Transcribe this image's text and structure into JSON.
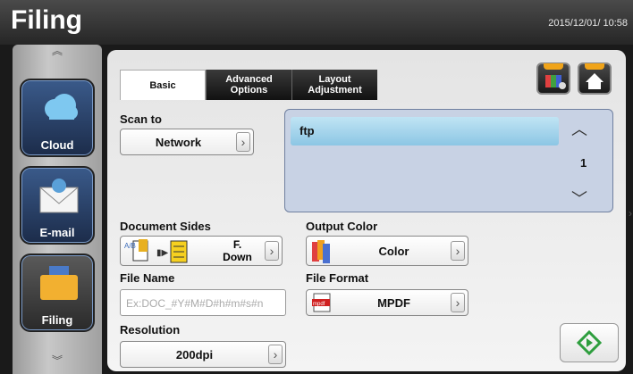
{
  "header": {
    "title": "Filing",
    "datetime": "2015/12/01/ 10:58"
  },
  "sidebar": {
    "items": [
      {
        "label": "Cloud",
        "icon": "cloud-icon"
      },
      {
        "label": "E-mail",
        "icon": "envelope-icon"
      },
      {
        "label": "Filing",
        "icon": "folder-icon"
      }
    ]
  },
  "tabs": [
    {
      "label": "Basic",
      "active": true
    },
    {
      "label": "Advanced Options",
      "active": false
    },
    {
      "label": "Layout Adjustment",
      "active": false
    }
  ],
  "toolbar": {
    "shortcut_icon": "color-settings-icon",
    "home_icon": "home-icon"
  },
  "scan_to": {
    "label": "Scan to",
    "value": "Network"
  },
  "destination_list": {
    "items": [
      "ftp"
    ],
    "page": "1"
  },
  "document_sides": {
    "label": "Document Sides",
    "value_line1": "F.",
    "value_line2": "Down"
  },
  "output_color": {
    "label": "Output Color",
    "value": "Color"
  },
  "file_name": {
    "label": "File Name",
    "placeholder": "Ex:DOC_#Y#M#D#h#m#s#n"
  },
  "file_format": {
    "label": "File Format",
    "value": "MPDF",
    "icon_text": "mpdf"
  },
  "resolution": {
    "label": "Resolution",
    "value": "200dpi"
  },
  "colors": {
    "accent_orange": "#f0a41a",
    "start_green": "#2e9e3e",
    "list_selected": "#8cc6e4"
  }
}
